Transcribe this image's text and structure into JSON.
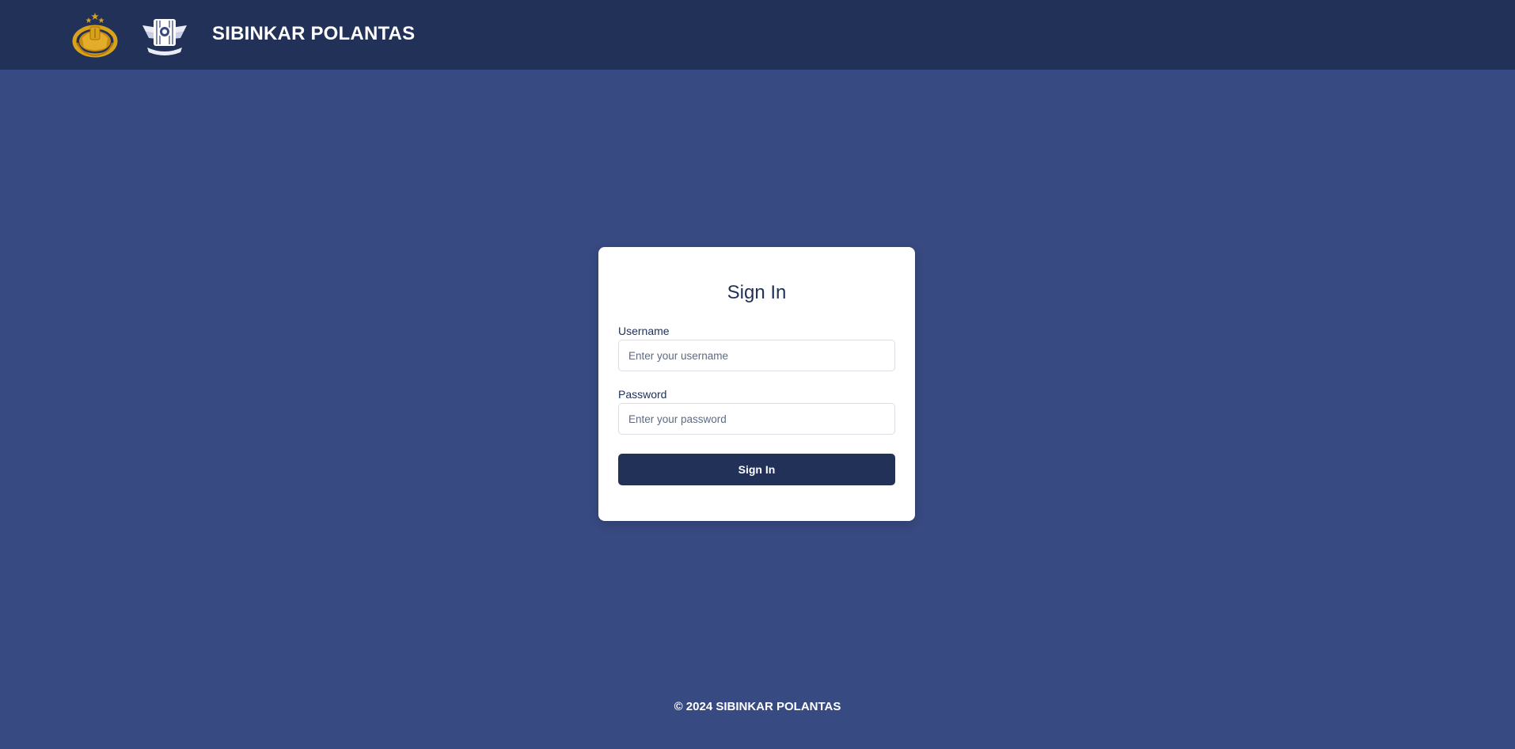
{
  "header": {
    "logos": [
      {
        "icon": "police-emblem-icon",
        "color": "#d9a21b"
      },
      {
        "icon": "traffic-police-emblem-icon",
        "color": "#ffffff"
      }
    ],
    "title": "SIBINKAR POLANTAS"
  },
  "login": {
    "title": "Sign In",
    "username": {
      "label": "Username",
      "value": "",
      "placeholder": "Enter your username"
    },
    "password": {
      "label": "Password",
      "value": "",
      "placeholder": "Enter your password"
    },
    "submit_label": "Sign In"
  },
  "footer": {
    "text": "© 2024 SIBINKAR POLANTAS"
  },
  "colors": {
    "header_bg": "#223158",
    "page_bg": "#384a82",
    "card_bg": "#ffffff",
    "button_bg": "#223158",
    "accent_gold": "#d9a21b"
  }
}
